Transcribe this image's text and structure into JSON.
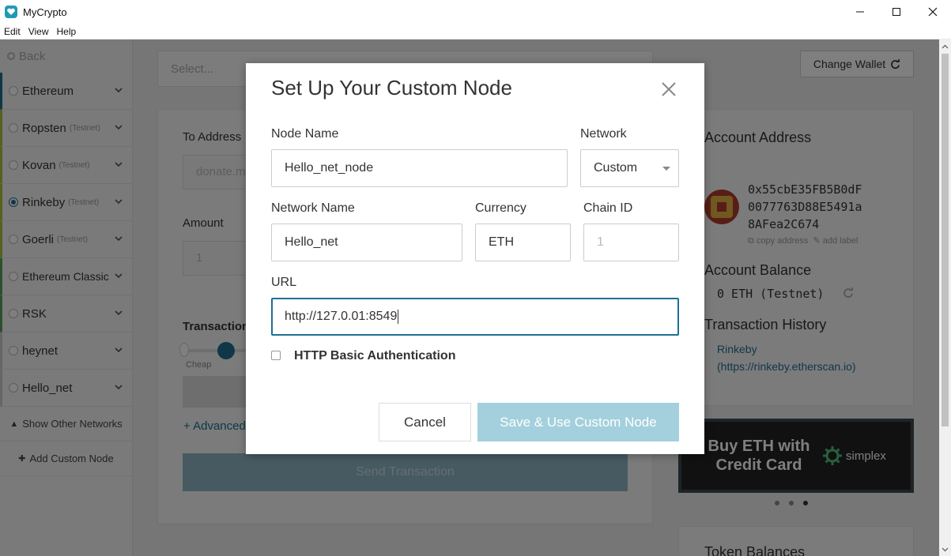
{
  "window": {
    "title": "MyCrypto"
  },
  "menu": [
    "Edit",
    "View",
    "Help"
  ],
  "sidebar": {
    "back_label": "Back",
    "networks": [
      {
        "name": "Ethereum",
        "tag": "",
        "color": "#1f6f93",
        "selected": false
      },
      {
        "name": "Ropsten",
        "tag": "(Testnet)",
        "color": "#a6c63a",
        "selected": false
      },
      {
        "name": "Kovan",
        "tag": "(Testnet)",
        "color": "#a6c63a",
        "selected": false
      },
      {
        "name": "Rinkeby",
        "tag": "(Testnet)",
        "color": "#a6c63a",
        "selected": true
      },
      {
        "name": "Goerli",
        "tag": "(Testnet)",
        "color": "#a6c63a",
        "selected": false
      },
      {
        "name": "Ethereum Classic",
        "tag": "",
        "color": "#5a9e5a",
        "selected": false
      },
      {
        "name": "RSK",
        "tag": "",
        "color": "#5a9e5a",
        "selected": false
      },
      {
        "name": "heynet",
        "tag": "",
        "color": "#cccccc",
        "selected": false
      },
      {
        "name": "Hello_net",
        "tag": "",
        "color": "#cccccc",
        "selected": false
      }
    ],
    "show_other_networks": "Show Other Networks",
    "add_custom_node": "Add Custom Node"
  },
  "main": {
    "select_placeholder": "Select...",
    "change_wallet": "Change Wallet",
    "to_address_label": "To Address",
    "to_address_placeholder": "donate.m",
    "amount_label": "Amount",
    "amount_placeholder": "1",
    "transaction_fee_label": "Transaction",
    "slider_label": "Cheap",
    "advanced_link": "+ Advanced",
    "send_button": "Send Transaction"
  },
  "account": {
    "address_heading": "Account Address",
    "address_lines": [
      "0x55cbE35FB5B0dF",
      "0077763D88E5491a",
      "8AFea2C674"
    ],
    "copy_address": "copy address",
    "add_label": "add label",
    "balance_heading": "Account Balance",
    "balance_value": "0 ETH (Testnet)",
    "history_heading": "Transaction History",
    "history_link": "Rinkeby (https://rinkeby.etherscan.io)",
    "banner_text": "Buy ETH with Credit Card",
    "banner_brand": "simplex",
    "token_heading": "Token Balances"
  },
  "modal": {
    "title": "Set Up Your Custom Node",
    "node_name_label": "Node Name",
    "node_name_value": "Hello_net_node",
    "network_label": "Network",
    "network_value": "Custom",
    "network_name_label": "Network Name",
    "network_name_value": "Hello_net",
    "currency_label": "Currency",
    "currency_value": "ETH",
    "chain_id_label": "Chain ID",
    "chain_id_placeholder": "1",
    "url_label": "URL",
    "url_value": "http://127.0.01:8549",
    "http_auth_label": "HTTP Basic Authentication",
    "cancel_button": "Cancel",
    "save_button": "Save & Use Custom Node"
  },
  "colors": {
    "accent": "#1f6f93",
    "save_button": "#a3d0dc",
    "send_button": "#8fb4c4"
  }
}
